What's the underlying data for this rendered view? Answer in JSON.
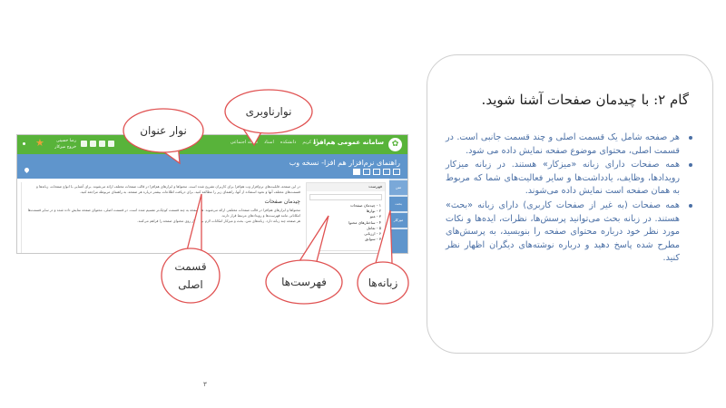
{
  "slide": {
    "title": "گام ۲: با چیدمان صفحات آشنا شوید.",
    "bullets": [
      "هر صفحه شامل یک قسمت اصلی و چند قسمت جانبی است. در قسمت اصلی، محتوای موضوع صفحه نمایش داده می شود.",
      "همه صفحات دارای زبانه «میزکار» هستند. در زبانه میزکار رویدادها، وظایف، یادداشت‌ها و سایر فعالیت‌های شما که مربوط به همان صفحه است نمایش داده می‌شوند.",
      "همه صفحات (به غیر از صفحات کاربری) دارای زبانه «بحث» هستند. در زبانه بحث می‌توانید پرسش‌ها، نظرات، ایده‌ها و نکات مورد نظر خود درباره محتوای صفحه را بنویسید، به پرسش‌های مطرح شده پاسخ دهید و درباره نوشته‌های دیگران اظهار نظر کنید."
    ],
    "page_number": "۳"
  },
  "callouts": {
    "navbar": "نوارناوبری",
    "titlebar": "نوار عنوان",
    "main_line1": "قسمت",
    "main_line2": "اصلی",
    "toc": "فهرست‌ها",
    "tabs": "زبانه‌ها"
  },
  "screenshot": {
    "brand": "سامانه عمومی هم‌افزا",
    "nav_links": [
      "فرآن کریم",
      "دانشکده",
      "اسناد",
      "شبکه اجتماعی"
    ],
    "user_line1": "رضا حسینی",
    "user_line2": "خروج   میزکار",
    "title": "راهنمای نرم‌افزار هم افزا- نسخه وب",
    "tabs": [
      "متن",
      "بحث",
      "میزکار"
    ],
    "toc_title": "فهرست",
    "toc_items": [
      "۱ - چیدمان صفحات",
      "۲ - نوارها",
      "۳ - منو",
      "۴ - ساختارهای محتوا",
      "۵ - تعامل",
      "۶ - ارزیابی",
      "۷ - سوابق"
    ],
    "main_para1": "در این صفحه، قابلیت‌های نرم‌افزار وب هم‌افزا برای کاربران تشریح شده است. محتواها و ابزارهای هم‌افزا در قالب صفحات مختلف ارائه می‌شوند. برای آشنایی با انواع صفحات، زبانه‌ها و قسمت‌های مختلف آنها و نحوه استفاده از آنها، راهنمای زیر را مطالعه کنید. برای دریافت اطلاعات بیشتر درباره هر صفحه، به راهنمای مربوطه مراجعه کنید.",
    "main_heading": "چیدمان صفحات",
    "main_para2": "محتواها و ابزارهای هم‌افزا در قالب صفحات مختلفی ارائه می‌شوند. هر صفحه به چند قسمت کوچک‌تر تقسیم شده است. در قسمت اصلی، محتوای صفحه نمایش داده شده و در سایر قسمت‌ها امکاناتی مانند فهرست‌ها و رویدادهای مرتبط قرار دارند.",
    "main_para3": "هر صفحه چند زبانه دارد. زبانه‌های متن، بحث و میزکار امکانات لازم برای کار روی محتوای صفحه را فراهم می‌کنند."
  }
}
